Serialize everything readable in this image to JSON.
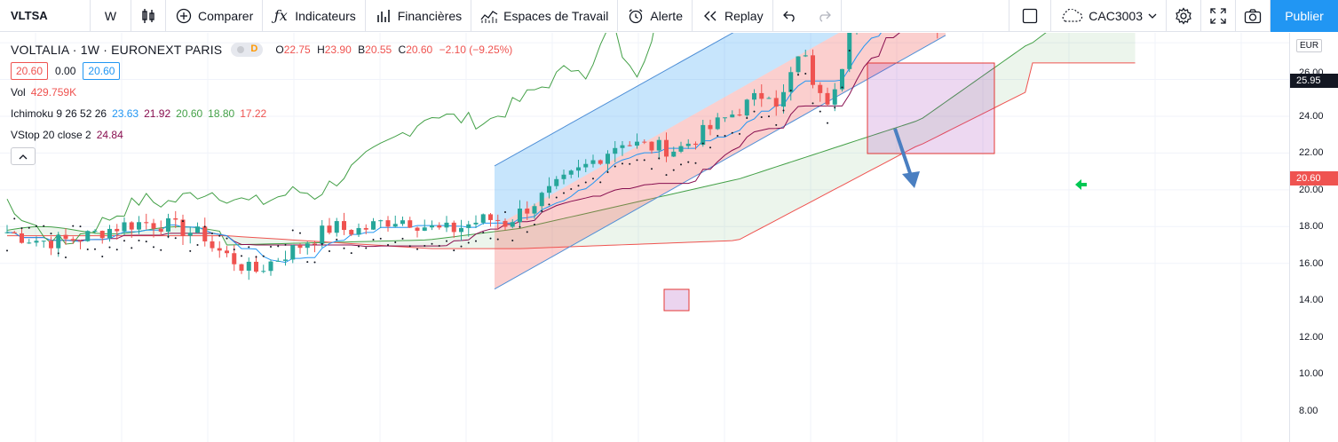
{
  "toolbar": {
    "symbol": "VLTSA",
    "interval": "W",
    "compare": "Comparer",
    "indicators": "Indicateurs",
    "financials": "Financières",
    "workspaces": "Espaces de Travail",
    "alert": "Alerte",
    "replay": "Replay",
    "layout_name": "CAC3003",
    "publish": "Publier"
  },
  "legend": {
    "title": "VOLTALIA · 1W · EURONEXT PARIS",
    "flag": "D",
    "ohlc": {
      "o_label": "O",
      "o": "22.75",
      "h_label": "H",
      "h": "23.90",
      "b_label": "B",
      "b": "20.55",
      "c_label": "C",
      "c": "20.60",
      "change": "−2.10 (−9.25%)"
    },
    "bid": "20.60",
    "spread": "0.00",
    "ask": "20.60",
    "vol_label": "Vol",
    "vol_value": "429.759K",
    "ichimoku_label": "Ichimoku 9 26 52 26",
    "ichimoku_values": [
      "23.63",
      "21.92",
      "20.60",
      "18.80",
      "17.22"
    ],
    "vstop_label": "VStop 20 close 2",
    "vstop_value": "24.84"
  },
  "price_axis": {
    "currency": "EUR",
    "ticks": [
      "26.00",
      "24.00",
      "22.00",
      "20.00",
      "18.00",
      "16.00",
      "14.00",
      "12.00",
      "10.00",
      "8.00"
    ],
    "hline_label": "25.95",
    "last_price_label": "20.60"
  },
  "colors": {
    "up": "#26a69a",
    "down": "#ef5350",
    "accent": "#2196f3",
    "tenkan": "#2196f3",
    "kijun": "#880e4f",
    "lagging": "#43a047",
    "span_a": "#43a047",
    "span_b": "#ef5350"
  }
}
